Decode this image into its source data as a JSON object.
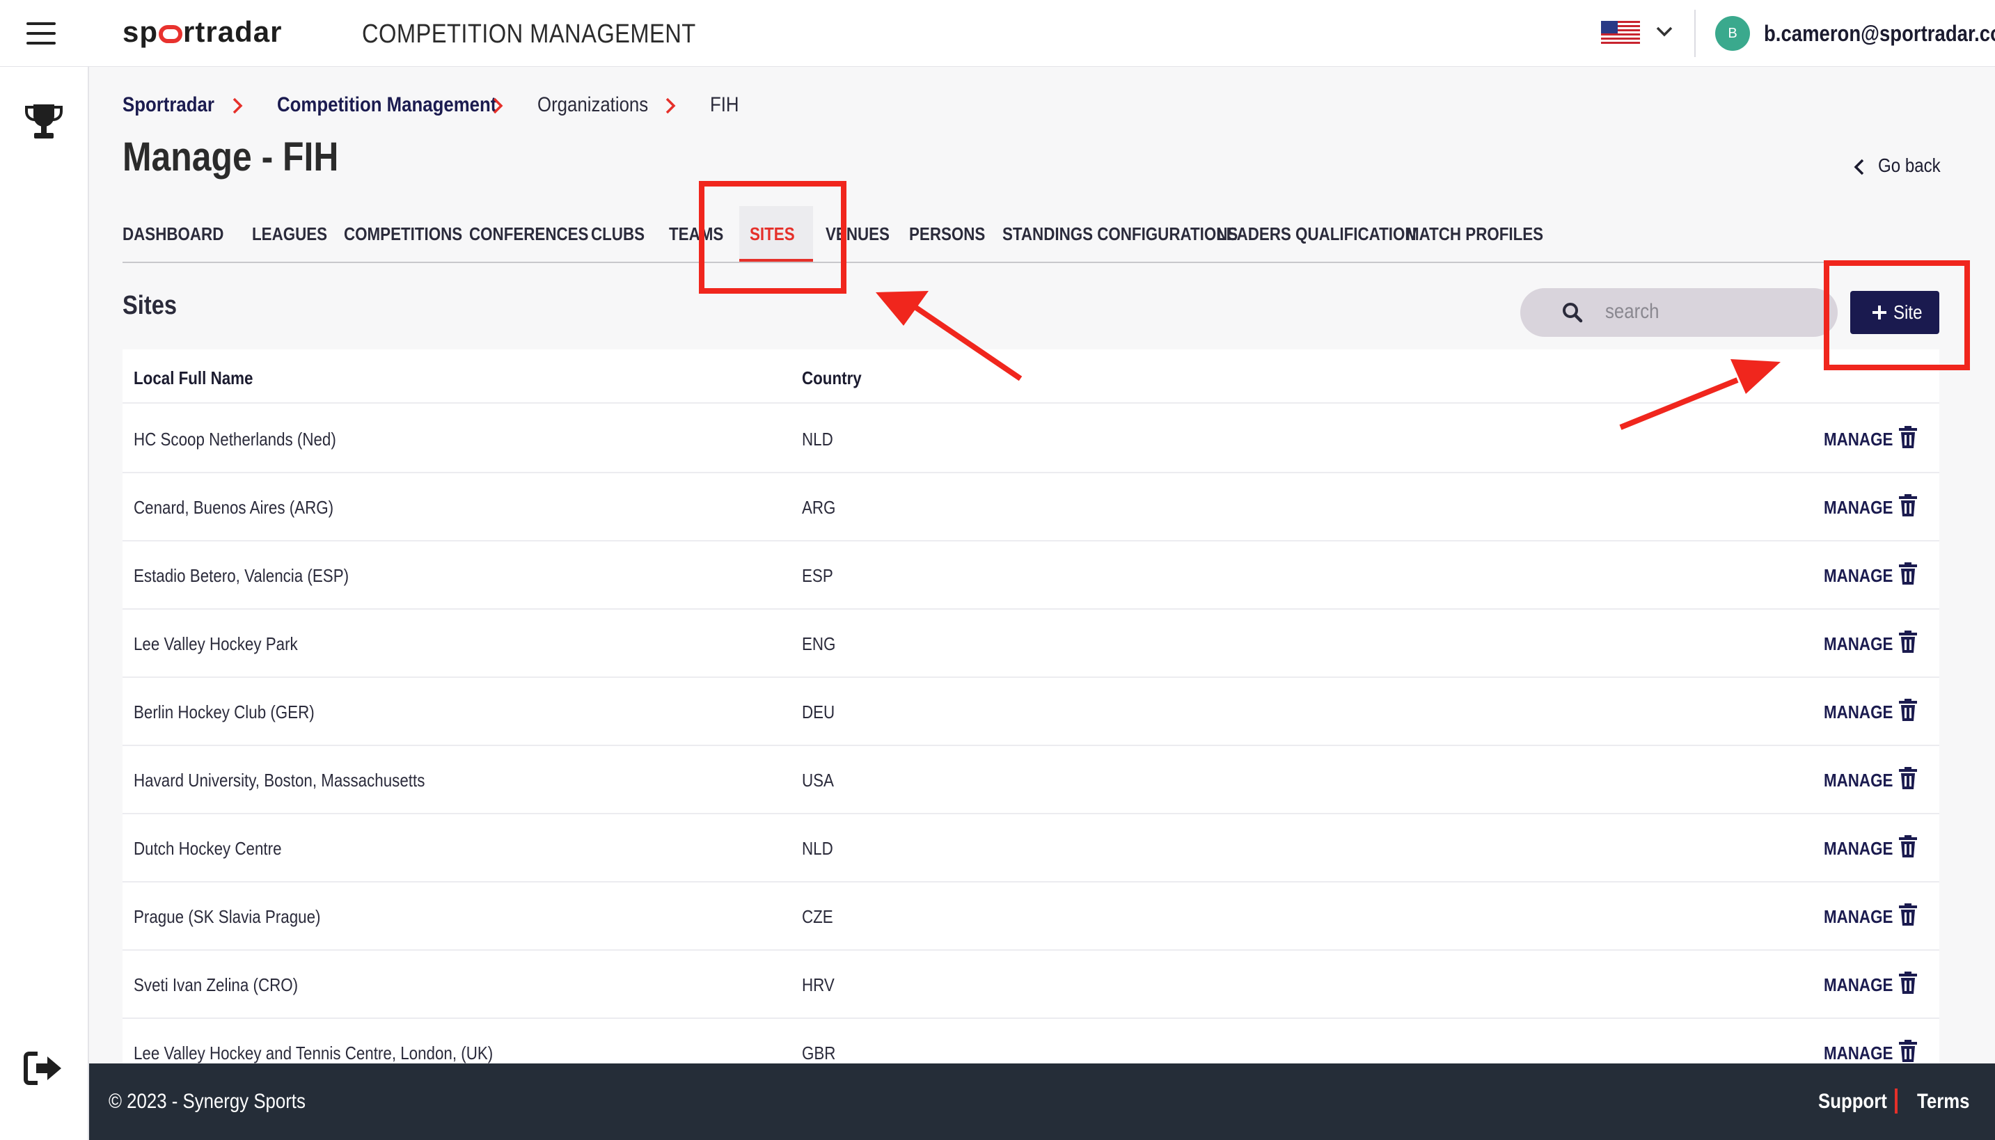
{
  "header": {
    "logo_text": "sportradar",
    "app_title": "COMPETITION MANAGEMENT",
    "user_initial": "B",
    "user_email": "b.cameron@sportradar.com"
  },
  "breadcrumb": [
    "Sportradar",
    "Competition Management",
    "Organizations",
    "FIH"
  ],
  "page": {
    "title": "Manage - FIH",
    "go_back": "Go back"
  },
  "tabs": [
    {
      "label": "DASHBOARD",
      "active": false
    },
    {
      "label": "LEAGUES",
      "active": false
    },
    {
      "label": "COMPETITIONS",
      "active": false
    },
    {
      "label": "CONFERENCES",
      "active": false
    },
    {
      "label": "CLUBS",
      "active": false
    },
    {
      "label": "TEAMS",
      "active": false
    },
    {
      "label": "SITES",
      "active": true
    },
    {
      "label": "VENUES",
      "active": false
    },
    {
      "label": "PERSONS",
      "active": false
    },
    {
      "label": "STANDINGS CONFIGURATIONS",
      "active": false
    },
    {
      "label": "LEADERS QUALIFICATION",
      "active": false
    },
    {
      "label": "MATCH PROFILES",
      "active": false
    }
  ],
  "sites": {
    "title": "Sites",
    "search_placeholder": "search",
    "add_label": "Site",
    "columns": [
      "Local Full Name",
      "Country"
    ],
    "action_label": "MANAGE",
    "rows": [
      {
        "name": "HC Scoop Netherlands (Ned)",
        "country": "NLD"
      },
      {
        "name": "Cenard, Buenos Aires (ARG)",
        "country": "ARG"
      },
      {
        "name": "Estadio Betero, Valencia (ESP)",
        "country": "ESP"
      },
      {
        "name": "Lee Valley Hockey Park",
        "country": "ENG"
      },
      {
        "name": "Berlin Hockey Club (GER)",
        "country": "DEU"
      },
      {
        "name": "Havard University, Boston, Massachusetts",
        "country": "USA"
      },
      {
        "name": "Dutch Hockey Centre",
        "country": "NLD"
      },
      {
        "name": "Prague (SK Slavia Prague)",
        "country": "CZE"
      },
      {
        "name": "Sveti Ivan Zelina (CRO)",
        "country": "HRV"
      },
      {
        "name": "Lee Valley Hockey and Tennis Centre, London, (UK)",
        "country": "GBR"
      }
    ]
  },
  "footer": {
    "copyright": "© 2023 - Synergy Sports",
    "support": "Support",
    "terms": "Terms"
  },
  "colors": {
    "accent_red": "#e5302a",
    "navy": "#1a1a4f",
    "footer_bg": "#252d38",
    "annotation_red": "#f0261d"
  },
  "icons": [
    "hamburger-icon",
    "us-flag-icon",
    "chevron-down-icon",
    "trophy-icon",
    "logout-icon",
    "chevron-right-icon",
    "chevron-left-icon",
    "search-icon",
    "plus-icon",
    "trash-icon"
  ]
}
